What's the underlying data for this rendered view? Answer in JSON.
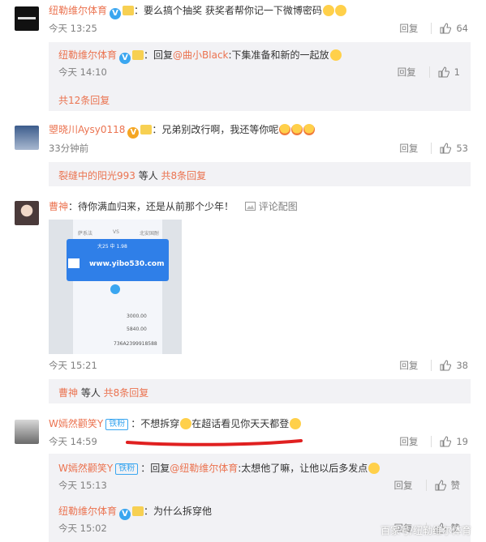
{
  "colors": {
    "accent": "#eb7350",
    "subbg": "#f2f2f5",
    "link": "#3aa6f0"
  },
  "comments": [
    {
      "name": "纽勒维尔体育",
      "text": "：要么搞个抽奖 获奖者帮你记一下微博密码",
      "time": "今天 13:25",
      "reply": "回复",
      "likes": "64"
    },
    {
      "name": "曌晓川Aysy0118",
      "text": "：兄弟别改行啊，我还等你呢",
      "time": "33分钟前",
      "reply": "回复",
      "likes": "53"
    },
    {
      "name": "曹神",
      "text": "：待你满血归来，还是从前那个少年！",
      "pic": "评论配图",
      "time": "今天 15:21",
      "reply": "回复",
      "likes": "38"
    },
    {
      "name": "W嫣然颧笑Y",
      "tag": "铁粉",
      "text": "：不想拆穿",
      "text2": "在超话看见你天天都登",
      "time": "今天 14:59",
      "reply": "回复",
      "likes": "19"
    }
  ],
  "subs": [
    {
      "name": "纽勒维尔体育",
      "pre": "：回复",
      "at": "@曲小Black",
      "text": ":下集准备和新的一起放",
      "time": "今天 14:10",
      "reply": "回复",
      "likes": "1"
    },
    {
      "more": "共12条回复"
    },
    {
      "users": "裂缝中的阳光993",
      "mid": " 等人 ",
      "more": "共8条回复"
    },
    {
      "users": "曹神",
      "mid": " 等人 ",
      "more": "共8条回复"
    },
    {
      "name": "W嫣然颧笑Y",
      "tag": "铁粉",
      "pre": "：回复",
      "at": "@纽勒维尔体育",
      "text": ":太想他了嘛，让他以后多发点",
      "time": "今天 15:13",
      "reply": "回复",
      "likes": "赞"
    },
    {
      "name": "纽勒维尔体育",
      "text": "：为什么拆穿他",
      "time": "今天 15:02",
      "reply": "回复",
      "likes": "赞"
    }
  ],
  "photo": {
    "amount": "大25 中 1.98",
    "site": "www.yibo530.com",
    "v1": "3000.00",
    "v2": "5840.00",
    "code": "736A2399918588",
    "tabs": [
      "萨系法",
      "VS",
      "北安国耐"
    ]
  },
  "watermark": "百家号/纽勒维尔体育"
}
